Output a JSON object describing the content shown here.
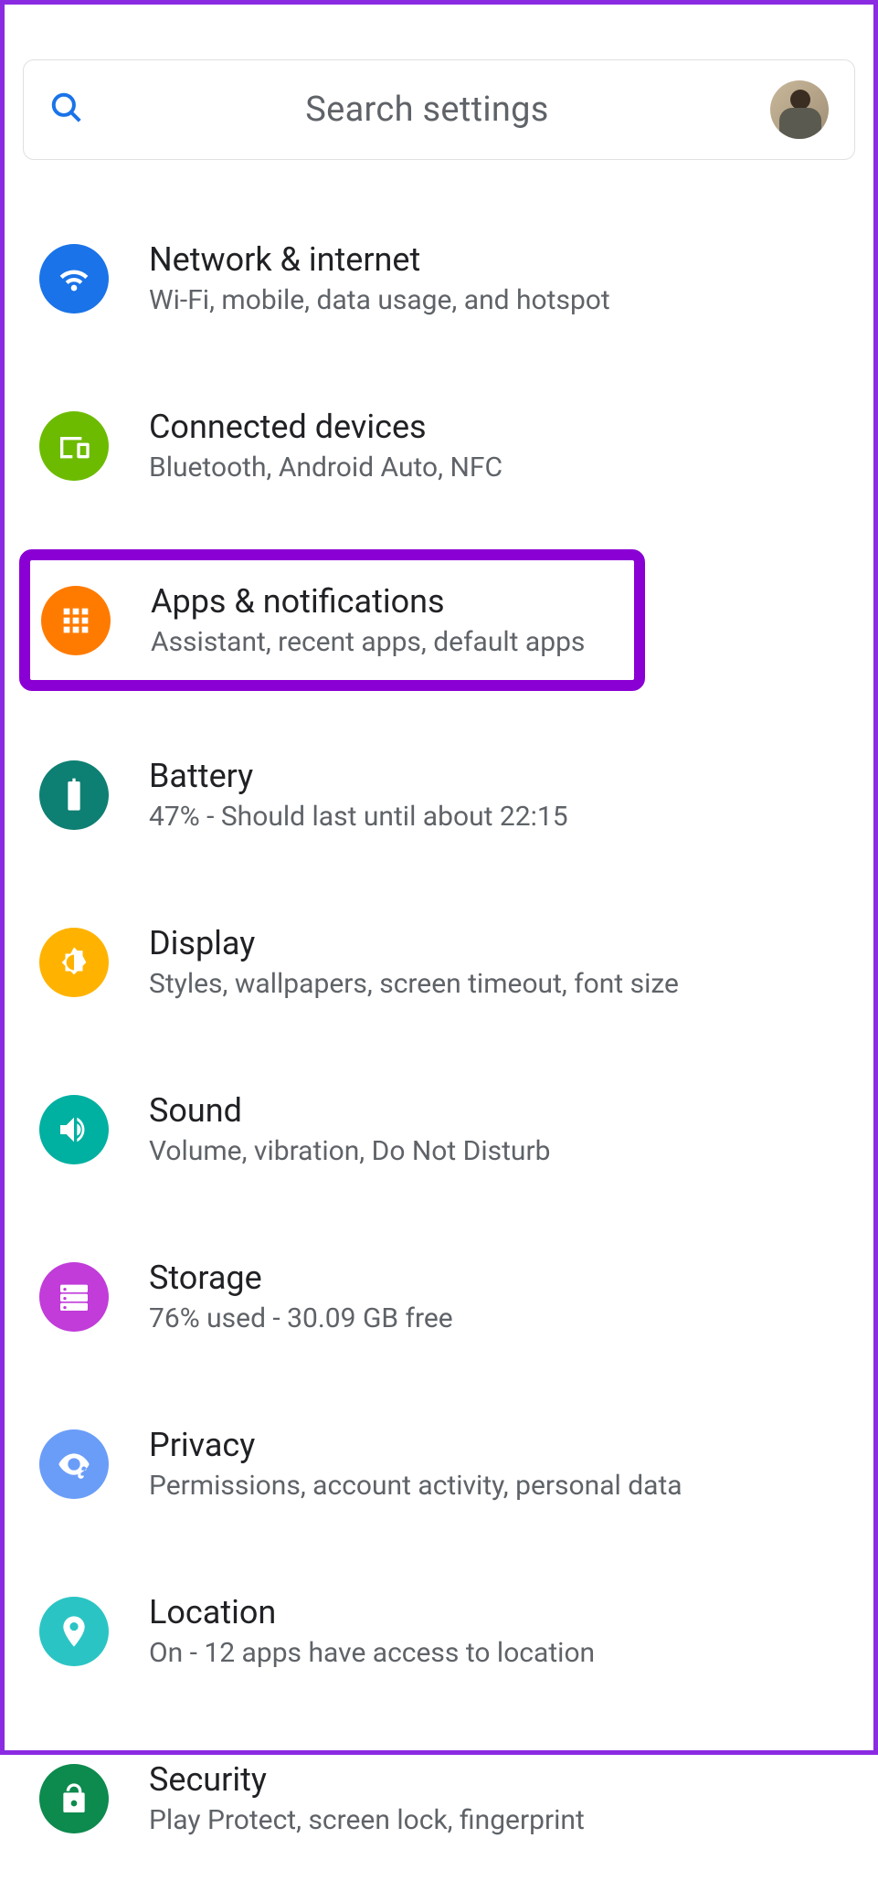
{
  "search": {
    "placeholder": "Search settings"
  },
  "items": [
    {
      "title": "Network & internet",
      "subtitle": "Wi-Fi, mobile, data usage, and hotspot",
      "icon": "wifi",
      "color": "c-blue",
      "highlighted": false
    },
    {
      "title": "Connected devices",
      "subtitle": "Bluetooth, Android Auto, NFC",
      "icon": "devices",
      "color": "c-green",
      "highlighted": false
    },
    {
      "title": "Apps & notifications",
      "subtitle": "Assistant, recent apps, default apps",
      "icon": "apps",
      "color": "c-orange",
      "highlighted": true
    },
    {
      "title": "Battery",
      "subtitle": "47% - Should last until about 22:15",
      "icon": "battery",
      "color": "c-teal",
      "highlighted": false
    },
    {
      "title": "Display",
      "subtitle": "Styles, wallpapers, screen timeout, font size",
      "icon": "brightness",
      "color": "c-yellow",
      "highlighted": false
    },
    {
      "title": "Sound",
      "subtitle": "Volume, vibration, Do Not Disturb",
      "icon": "volume",
      "color": "c-teal2",
      "highlighted": false
    },
    {
      "title": "Storage",
      "subtitle": "76% used - 30.09 GB free",
      "icon": "storage",
      "color": "c-purple",
      "highlighted": false
    },
    {
      "title": "Privacy",
      "subtitle": "Permissions, account activity, personal data",
      "icon": "privacy",
      "color": "c-lblue",
      "highlighted": false
    },
    {
      "title": "Location",
      "subtitle": "On - 12 apps have access to location",
      "icon": "location",
      "color": "c-cyan",
      "highlighted": false
    },
    {
      "title": "Security",
      "subtitle": "Play Protect, screen lock, fingerprint",
      "icon": "security",
      "color": "c-dgreen",
      "highlighted": false
    }
  ]
}
